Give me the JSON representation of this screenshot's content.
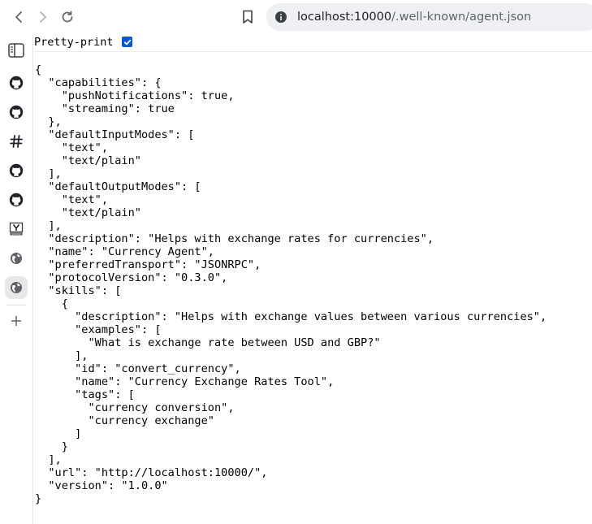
{
  "browser": {
    "url_host": "localhost:10000",
    "url_path": "/.well-known/agent.json",
    "back_icon": "chevron-left",
    "forward_icon": "chevron-right",
    "reload_icon": "reload",
    "bookmark_icon": "bookmark",
    "site_info_icon": "info"
  },
  "sidebar": {
    "items": [
      {
        "icon": "side-panel-icon"
      },
      {
        "icon": "github-icon"
      },
      {
        "icon": "github-icon"
      },
      {
        "icon": "hashtag-icon"
      },
      {
        "icon": "github-icon"
      },
      {
        "icon": "github-icon"
      },
      {
        "icon": "ycombinator-icon"
      },
      {
        "icon": "globe-icon"
      },
      {
        "icon": "globe-icon",
        "active": true
      },
      {
        "icon": "plus-icon"
      }
    ]
  },
  "viewer": {
    "pretty_print_label": "Pretty-print",
    "pretty_print_checked": true,
    "json_text": "{\n  \"capabilities\": {\n    \"pushNotifications\": true,\n    \"streaming\": true\n  },\n  \"defaultInputModes\": [\n    \"text\",\n    \"text/plain\"\n  ],\n  \"defaultOutputModes\": [\n    \"text\",\n    \"text/plain\"\n  ],\n  \"description\": \"Helps with exchange rates for currencies\",\n  \"name\": \"Currency Agent\",\n  \"preferredTransport\": \"JSONRPC\",\n  \"protocolVersion\": \"0.3.0\",\n  \"skills\": [\n    {\n      \"description\": \"Helps with exchange values between various currencies\",\n      \"examples\": [\n        \"What is exchange rate between USD and GBP?\"\n      ],\n      \"id\": \"convert_currency\",\n      \"name\": \"Currency Exchange Rates Tool\",\n      \"tags\": [\n        \"currency conversion\",\n        \"currency exchange\"\n      ]\n    }\n  ],\n  \"url\": \"http://localhost:10000/\",\n  \"version\": \"1.0.0\"\n}"
  },
  "colors": {
    "accent": "#0b57d0",
    "urlbar_bg": "#eef0f3"
  }
}
